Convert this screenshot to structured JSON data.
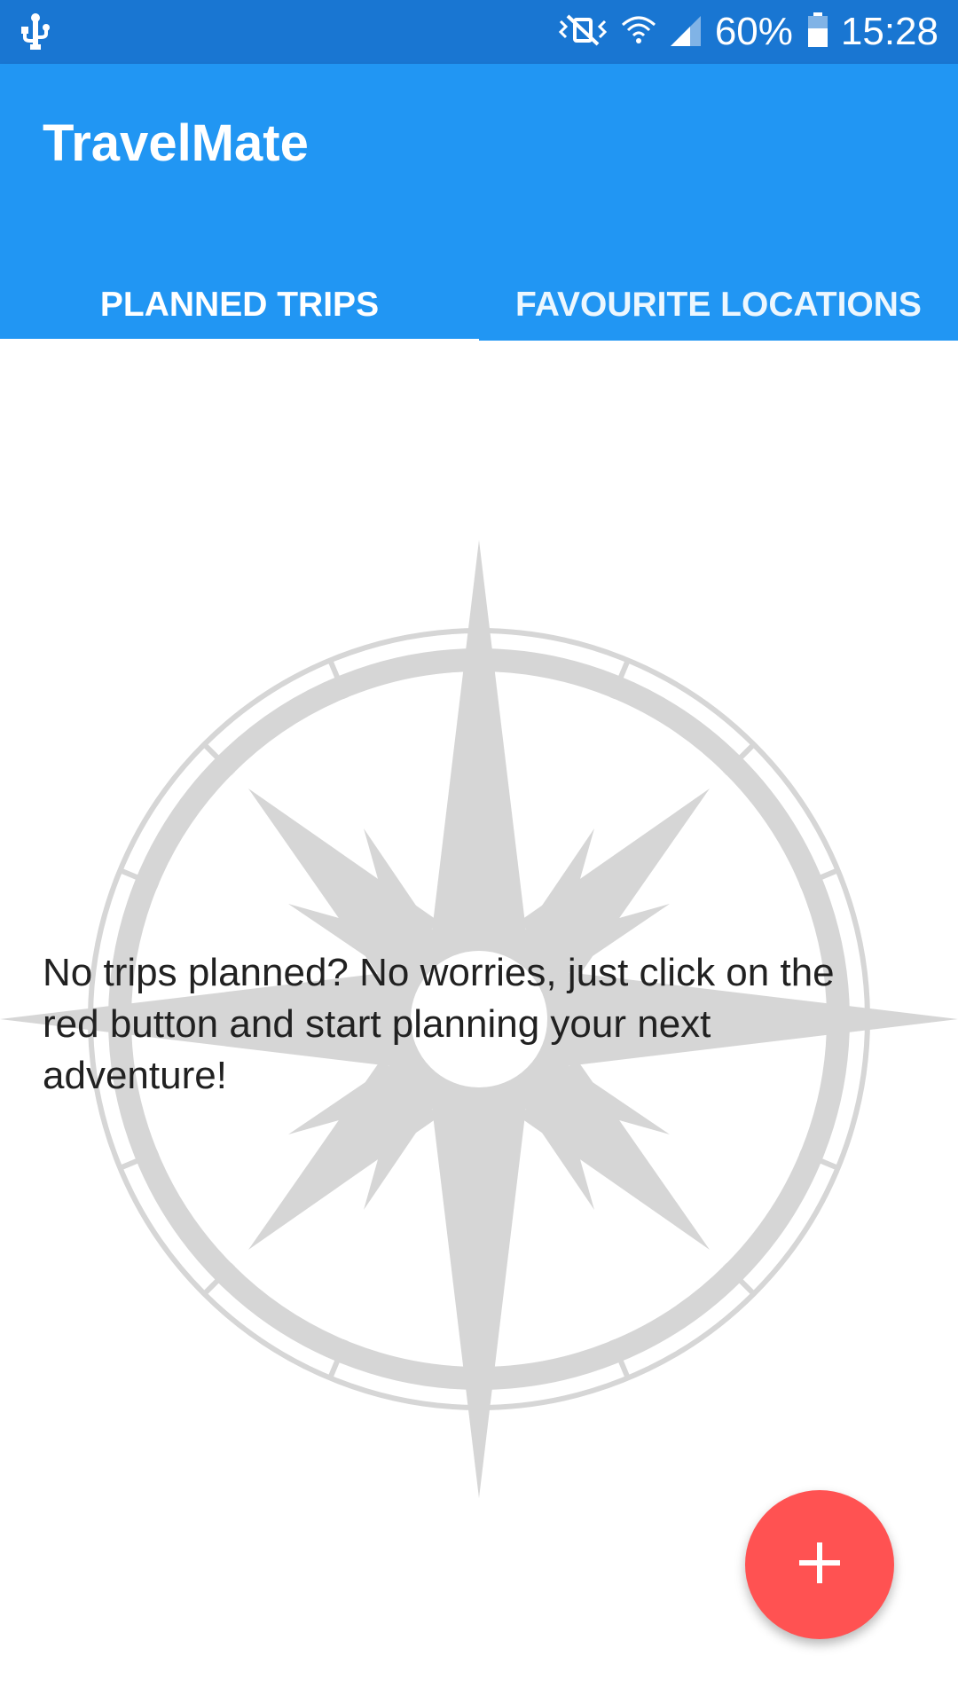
{
  "status_bar": {
    "battery_percent": "60%",
    "time": "15:28",
    "icons": [
      "usb-icon",
      "vibrate-mute-icon",
      "wifi-icon",
      "signal-icon",
      "battery-icon"
    ]
  },
  "app_bar": {
    "title": "TravelMate",
    "tabs": [
      {
        "label": "PLANNED TRIPS",
        "selected": true
      },
      {
        "label": "FAVOURITE LOCATIONS",
        "selected": false
      }
    ]
  },
  "main": {
    "empty_message": "No trips planned? No worries, just click on the red button and start planning your next adventure!",
    "background_icon": "compass-rose-icon"
  },
  "fab": {
    "icon": "plus-icon"
  },
  "colors": {
    "status_bar": "#1976D2",
    "app_bar": "#2196F3",
    "fab": "#FF5252",
    "compass": "#D6D6D6",
    "text": "#212121"
  }
}
